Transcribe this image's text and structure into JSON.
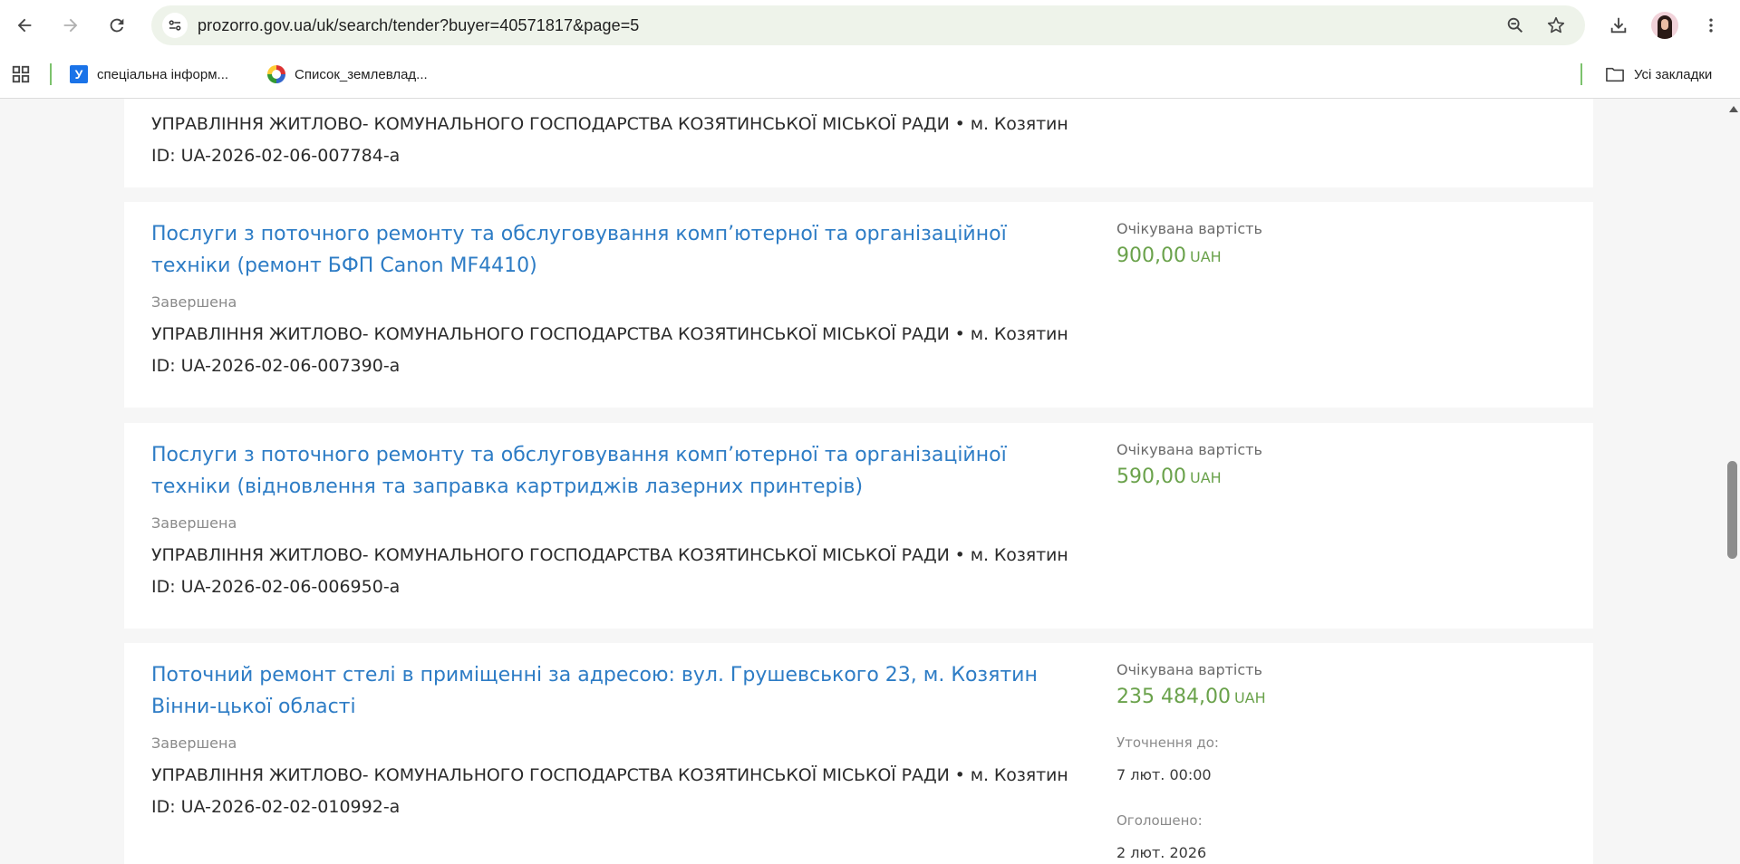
{
  "browser": {
    "url_host": "prozorro.gov.ua",
    "url_path": "/uk/search/tender?buyer=40571817&page=5",
    "bookmarks": [
      {
        "label": "спеціальна інформ...",
        "icon": "y-favicon"
      },
      {
        "label": "Список_землевлад...",
        "icon": "wikipedia-favicon"
      }
    ],
    "all_bookmarks_label": "Усі закладки"
  },
  "tenders": [
    {
      "title": "",
      "status": "",
      "buyer": "УПРАВЛІННЯ ЖИТЛОВО- КОМУНАЛЬНОГО ГОСПОДАРСТВА КОЗЯТИНСЬКОЇ МІСЬКОЇ РАДИ • м. Козятин",
      "id": "ID: UA-2026-02-06-007784-a"
    },
    {
      "title": "Послуги з поточного ремонту та обслуговування комп’ютерної та організаційної техніки (ремонт БФП Canon MF4410)",
      "status": "Завершена",
      "buyer": "УПРАВЛІННЯ ЖИТЛОВО- КОМУНАЛЬНОГО ГОСПОДАРСТВА КОЗЯТИНСЬКОЇ МІСЬКОЇ РАДИ • м. Козятин",
      "id": "ID: UA-2026-02-06-007390-a",
      "value_label": "Очікувана вартість",
      "amount": "900,00",
      "currency": "UAH"
    },
    {
      "title": "Послуги з поточного ремонту та обслуговування комп’ютерної та організаційної техніки (відновлення та заправка картриджів лазерних принтерів)",
      "status": "Завершена",
      "buyer": "УПРАВЛІННЯ ЖИТЛОВО- КОМУНАЛЬНОГО ГОСПОДАРСТВА КОЗЯТИНСЬКОЇ МІСЬКОЇ РАДИ • м. Козятин",
      "id": "ID: UA-2026-02-06-006950-a",
      "value_label": "Очікувана вартість",
      "amount": "590,00",
      "currency": "UAH"
    },
    {
      "title": "Поточний ремонт стелі в приміщенні за адресою: вул. Грушевського 23, м. Козятин Вінни-цької області",
      "status": "Завершена",
      "buyer": "УПРАВЛІННЯ ЖИТЛОВО- КОМУНАЛЬНОГО ГОСПОДАРСТВА КОЗЯТИНСЬКОЇ МІСЬКОЇ РАДИ • м. Козятин",
      "id": "ID: UA-2026-02-02-010992-a",
      "value_label": "Очікувана вартість",
      "amount": "235 484,00",
      "currency": "UAH",
      "clarification_label": "Уточнення до:",
      "clarification_value": "7 лют. 00:00",
      "announced_label": "Оголошено:",
      "announced_value": "2 лют. 2026"
    }
  ],
  "colors": {
    "link": "#2d7cc5",
    "amount": "#6aa24b",
    "omnibox": "#eef3ea",
    "bookmark_separator": "#7cc26d"
  }
}
